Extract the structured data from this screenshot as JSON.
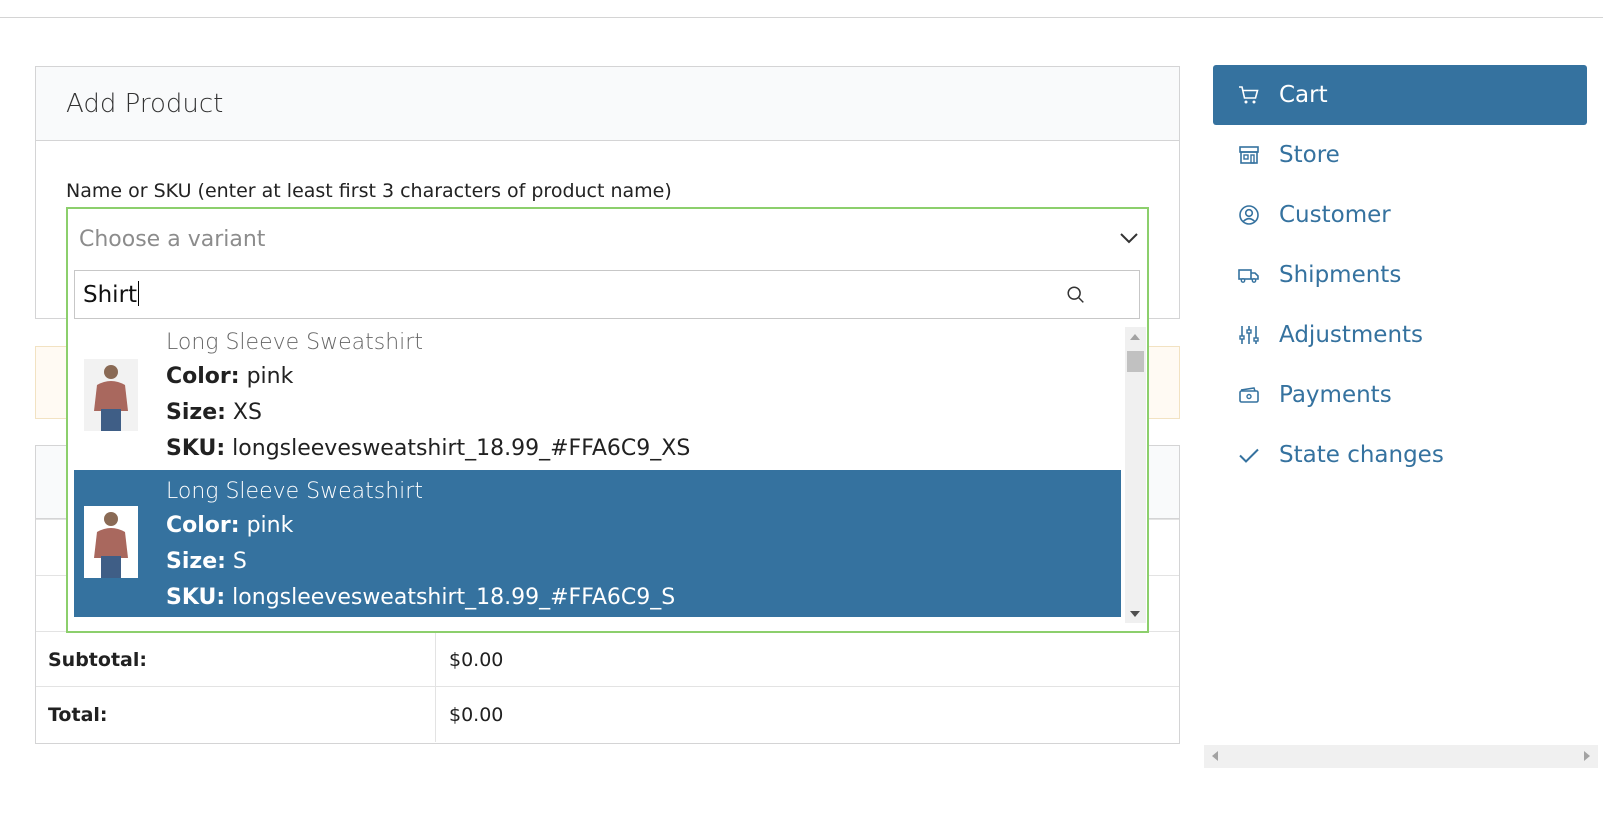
{
  "add_product": {
    "title": "Add Product",
    "field_label": "Name or SKU (enter at least first 3 characters of product name)",
    "select_placeholder": "Choose a variant",
    "search_value": "Shirt",
    "options": [
      {
        "name": "Long Sleeve Sweatshirt",
        "color_label": "Color:",
        "color": "pink",
        "size_label": "Size:",
        "size": "XS",
        "sku_label": "SKU:",
        "sku": "longsleevesweatshirt_18.99_#FFA6C9_XS",
        "selected": false
      },
      {
        "name": "Long Sleeve Sweatshirt",
        "color_label": "Color:",
        "color": "pink",
        "size_label": "Size:",
        "size": "S",
        "sku_label": "SKU:",
        "sku": "longsleevesweatshirt_18.99_#FFA6C9_S",
        "selected": true
      }
    ]
  },
  "totals": {
    "subtotal_label": "Subtotal:",
    "subtotal_value": "$0.00",
    "total_label": "Total:",
    "total_value": "$0.00"
  },
  "menu": {
    "items": [
      {
        "label": "Cart",
        "icon": "cart-icon",
        "active": true
      },
      {
        "label": "Store",
        "icon": "store-icon",
        "active": false
      },
      {
        "label": "Customer",
        "icon": "user-circle-icon",
        "active": false
      },
      {
        "label": "Shipments",
        "icon": "truck-icon",
        "active": false
      },
      {
        "label": "Adjustments",
        "icon": "sliders-icon",
        "active": false
      },
      {
        "label": "Payments",
        "icon": "payment-icon",
        "active": false
      },
      {
        "label": "State changes",
        "icon": "check-icon",
        "active": false
      }
    ]
  },
  "colors": {
    "accent": "#35729f",
    "select_border": "#8ccf6c",
    "warning_bg": "#fffaf3"
  }
}
